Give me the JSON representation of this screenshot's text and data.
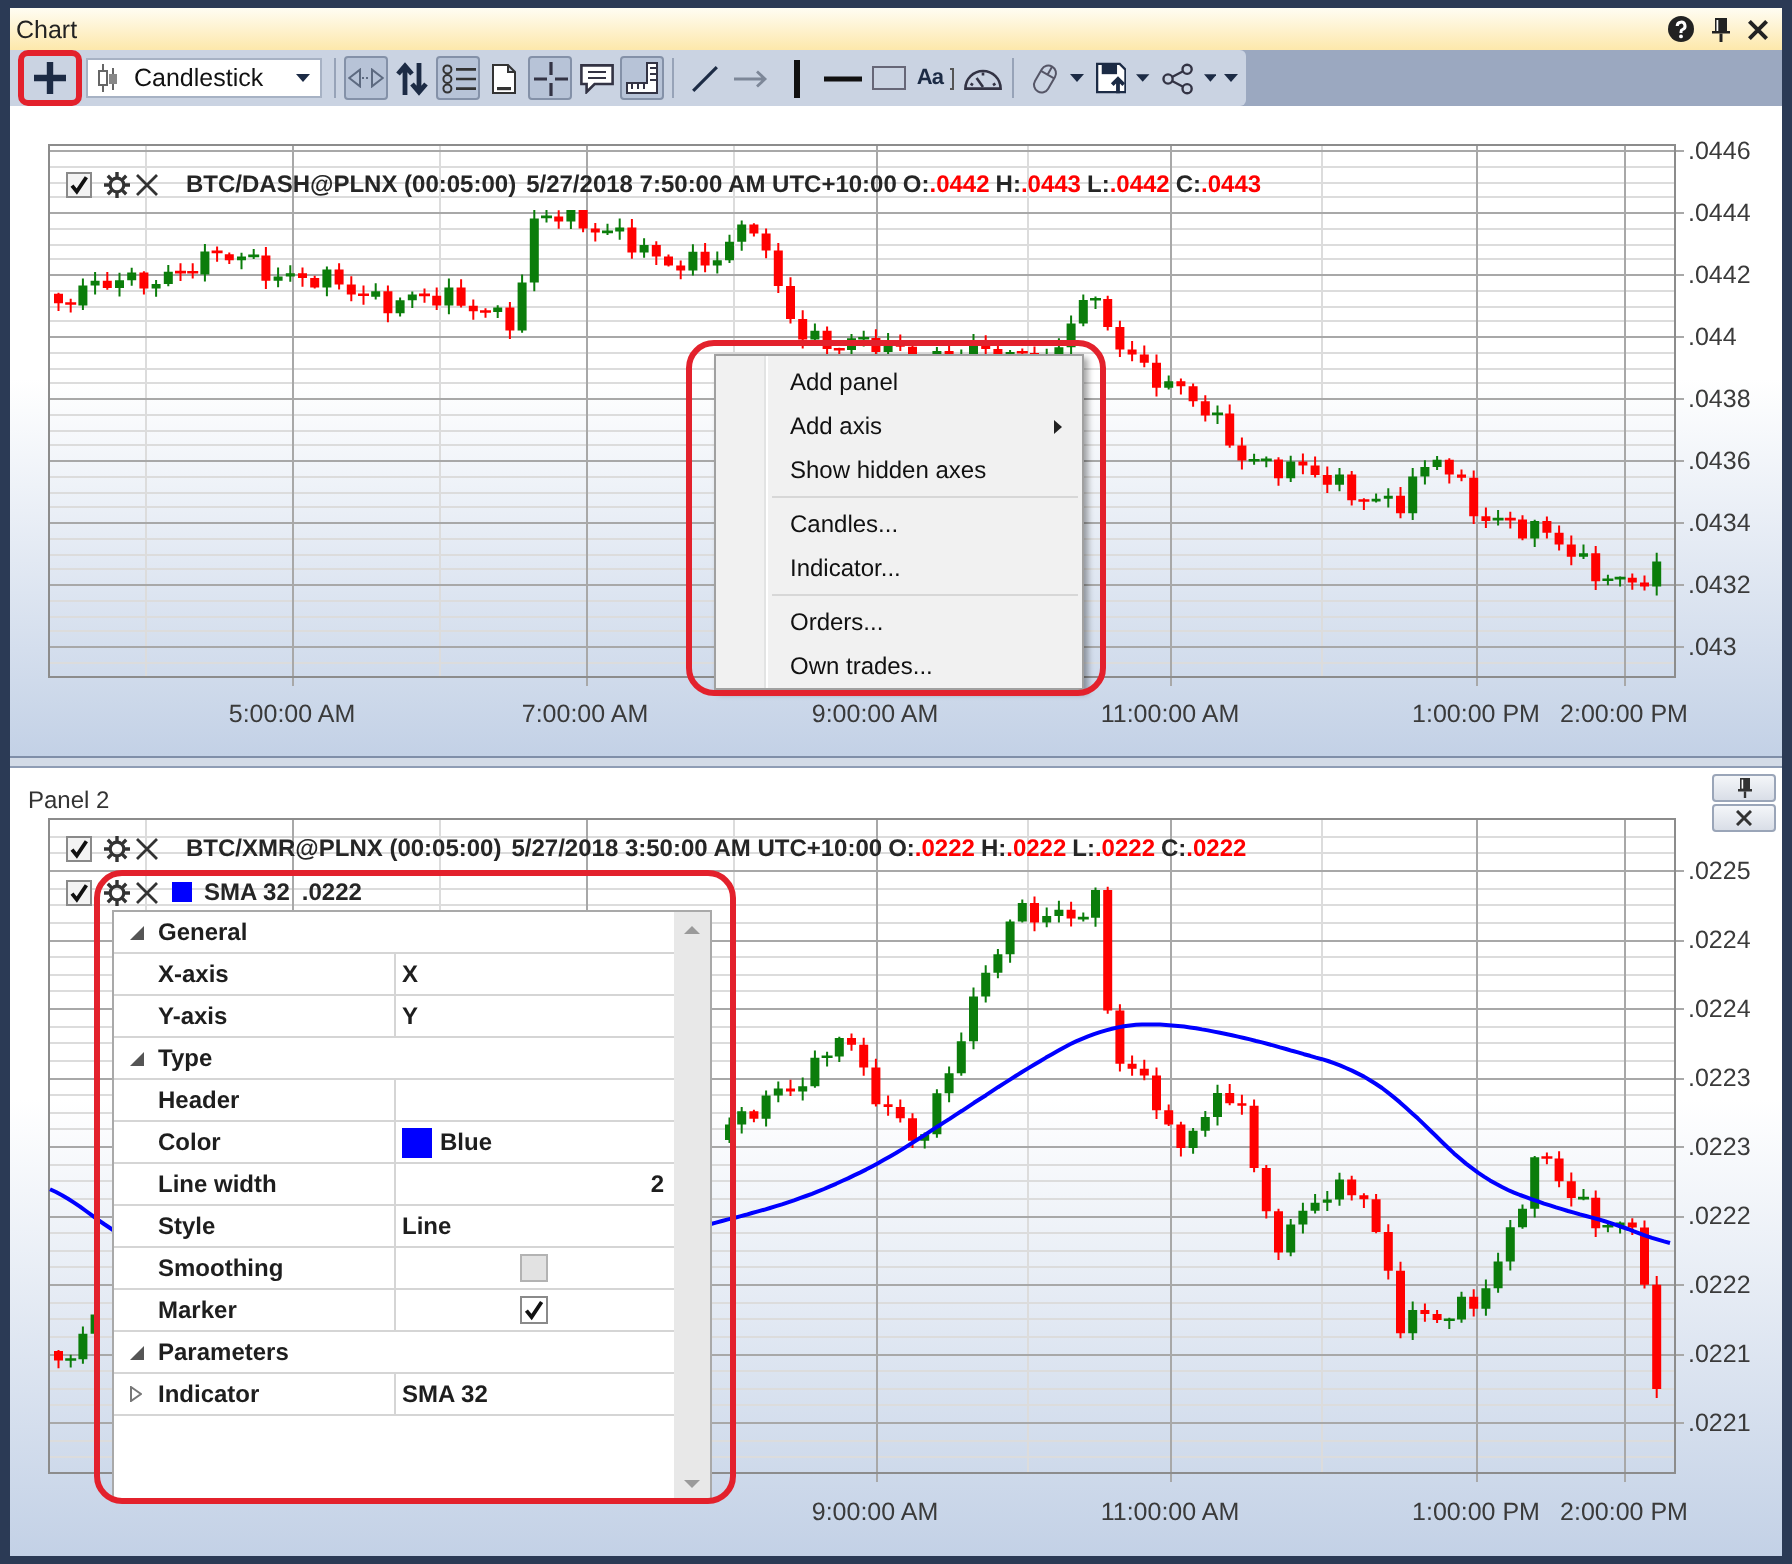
{
  "window": {
    "title": "Chart"
  },
  "toolbar": [
    {
      "kind": "add",
      "pressed": false,
      "dropdown": false,
      "highlighted": true
    },
    {
      "kind": "select",
      "value": "Candlestick"
    },
    {
      "kind": "separator"
    },
    {
      "kind": "scroll",
      "pressed": true,
      "dropdown": false,
      "highlighted": false
    },
    {
      "kind": "swap",
      "pressed": false,
      "dropdown": false,
      "highlighted": false
    },
    {
      "kind": "legend",
      "pressed": true,
      "dropdown": false,
      "highlighted": false
    },
    {
      "kind": "document",
      "pressed": false,
      "dropdown": false,
      "highlighted": false
    },
    {
      "kind": "crosshair",
      "pressed": true,
      "dropdown": false,
      "highlighted": false
    },
    {
      "kind": "comment",
      "pressed": false,
      "dropdown": false,
      "highlighted": false
    },
    {
      "kind": "ruler",
      "pressed": true,
      "dropdown": false,
      "highlighted": false
    },
    {
      "kind": "separator"
    },
    {
      "kind": "line",
      "pressed": false,
      "dropdown": false,
      "highlighted": false
    },
    {
      "kind": "arrow",
      "pressed": false,
      "dropdown": false,
      "highlighted": false
    },
    {
      "kind": "vertical-line",
      "pressed": false,
      "dropdown": false,
      "highlighted": false
    },
    {
      "kind": "horizontal-line",
      "pressed": false,
      "dropdown": false,
      "highlighted": false
    },
    {
      "kind": "rectangle",
      "pressed": false,
      "dropdown": false,
      "highlighted": false
    },
    {
      "kind": "text",
      "label": "Aa",
      "pressed": false,
      "dropdown": false,
      "highlighted": false
    },
    {
      "kind": "gauge",
      "pressed": false,
      "dropdown": false,
      "highlighted": false
    },
    {
      "kind": "separator"
    },
    {
      "kind": "mouse",
      "pressed": false,
      "dropdown": true,
      "highlighted": false
    },
    {
      "kind": "save",
      "pressed": false,
      "dropdown": true,
      "highlighted": false
    },
    {
      "kind": "share",
      "pressed": false,
      "dropdown": true,
      "highlighted": false
    },
    {
      "kind": "overflow",
      "pressed": false,
      "dropdown": false,
      "highlighted": false
    }
  ],
  "panels": [
    {
      "legends": [
        {
          "kind": "candles",
          "visible": true,
          "name": "BTC/DASH@PLNX (00:05:00)",
          "time": "5/27/2018 7:50:00 AM UTC+10:00",
          "values": [
            {
              "label": "O:",
              "value": ".0442"
            },
            {
              "label": "H:",
              "value": ".0443"
            },
            {
              "label": "L:",
              "value": ".0442"
            },
            {
              "label": "C:",
              "value": ".0443"
            }
          ]
        }
      ],
      "y_axis_labels": [
        ".0446",
        ".0444",
        ".0442",
        ".044",
        ".0438",
        ".0436",
        ".0434",
        ".0432",
        ".043"
      ],
      "x_axis_labels": [
        "5:00:00 AM",
        "7:00:00 AM",
        "9:00:00 AM",
        "11:00:00 AM",
        "1:00:00 PM",
        "2:00:00 PM"
      ],
      "context_menu": {
        "highlighted": true,
        "sections": [
          {
            "items": [
              {
                "label": "Add panel",
                "submenu": false
              },
              {
                "label": "Add axis",
                "submenu": true
              },
              {
                "label": "Show hidden axes",
                "submenu": false
              }
            ]
          },
          {
            "items": [
              {
                "label": "Candles...",
                "submenu": false
              },
              {
                "label": "Indicator...",
                "submenu": false
              }
            ]
          },
          {
            "items": [
              {
                "label": "Orders...",
                "submenu": false
              },
              {
                "label": "Own trades...",
                "submenu": false
              }
            ]
          }
        ]
      }
    },
    {
      "title": "Panel 2",
      "legends": [
        {
          "kind": "candles",
          "visible": true,
          "name": "BTC/XMR@PLNX (00:05:00)",
          "time": "5/27/2018 3:50:00 AM UTC+10:00",
          "values": [
            {
              "label": "O:",
              "value": ".0222"
            },
            {
              "label": "H:",
              "value": ".0222"
            },
            {
              "label": "L:",
              "value": ".0222"
            },
            {
              "label": "C:",
              "value": ".0222"
            }
          ]
        },
        {
          "kind": "indicator",
          "visible": true,
          "color": "#0000ff",
          "name": "SMA 32",
          "value": ".0222"
        }
      ],
      "y_axis_labels": [
        ".0225",
        ".0224",
        ".0224",
        ".0223",
        ".0223",
        ".0222",
        ".0222",
        ".0221",
        ".0221"
      ],
      "x_axis_labels": [
        "9:00:00 AM",
        "11:00:00 AM",
        "1:00:00 PM",
        "2:00:00 PM"
      ],
      "property_grid": {
        "highlighted": true,
        "categories": [
          {
            "label": "General",
            "expanded": true,
            "rows": [
              {
                "kind": "text",
                "name": "X-axis",
                "value": "X"
              },
              {
                "kind": "text",
                "name": "Y-axis",
                "value": "Y"
              }
            ]
          },
          {
            "label": "Type",
            "expanded": true,
            "rows": [
              {
                "kind": "text",
                "name": "Header"
              },
              {
                "kind": "color",
                "name": "Color",
                "color": "#0000ff",
                "value": "Blue"
              },
              {
                "kind": "number",
                "name": "Line width",
                "value": "2"
              },
              {
                "kind": "text",
                "name": "Style",
                "value": "Line"
              },
              {
                "kind": "check",
                "name": "Smoothing",
                "checked": false
              },
              {
                "kind": "check",
                "name": "Marker",
                "checked": true
              }
            ]
          },
          {
            "label": "Parameters",
            "expanded": true,
            "rows": [
              {
                "kind": "group",
                "name": "Indicator",
                "expanded": false,
                "value": "SMA 32"
              }
            ]
          }
        ]
      }
    }
  ]
}
